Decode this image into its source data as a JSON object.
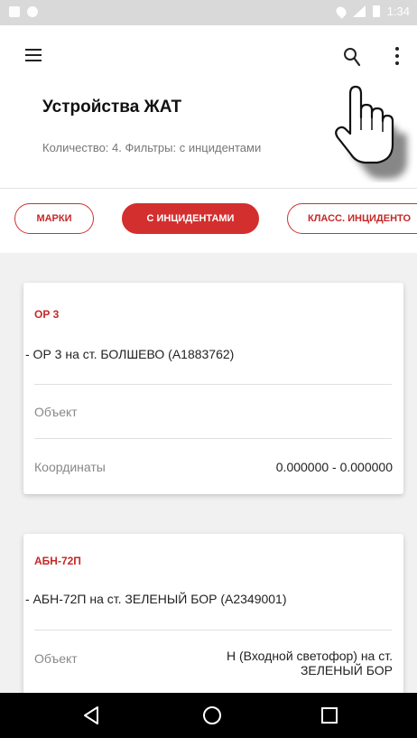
{
  "status_bar": {
    "time": "1:34"
  },
  "header": {
    "title": "Устройства ЖАТ",
    "subtitle": "Количество: 4.  Фильтры: с инцидентами"
  },
  "chips": [
    {
      "label": "МАРКИ",
      "selected": false
    },
    {
      "label": "С ИНЦИДЕНТАМИ",
      "selected": true
    },
    {
      "label": "КЛАСС. ИНЦИДЕНТО",
      "selected": false
    }
  ],
  "cards": [
    {
      "title": "ОР 3",
      "description": "- ОР 3 на ст. БОЛШЕВО (A1883762)",
      "object_label": "Объект",
      "object_value": "",
      "coords_label": "Координаты",
      "coords_value": "0.000000 - 0.000000"
    },
    {
      "title": "АБН-72П",
      "description": "- АБН-72П на ст. ЗЕЛЕНЫЙ БОР (A2349001)",
      "object_label": "Объект",
      "object_value_line1": "Н (Входной светофор) на ст.",
      "object_value_line2": "ЗЕЛЕНЫЙ БОР"
    }
  ],
  "colors": {
    "accent": "#d32f2f",
    "status_bar": "#d9d9d9",
    "list_background": "#f1f1f1",
    "nav_bar": "#000000"
  },
  "icons": [
    "menu-icon",
    "search-icon",
    "more-vert-icon",
    "pointing-hand-icon",
    "back-icon",
    "home-icon",
    "recents-icon"
  ]
}
